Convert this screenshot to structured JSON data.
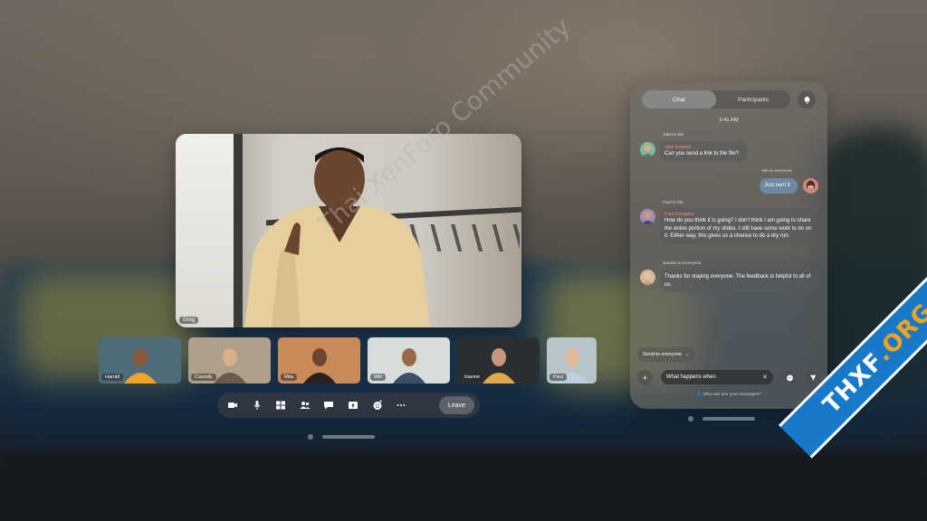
{
  "main_video": {
    "name": "Greg"
  },
  "participants": [
    {
      "name": "Harold",
      "bg": "#4d6b78",
      "skin": "#8a5a3c",
      "shirt": "#f0a32a"
    },
    {
      "name": "Cassidy",
      "bg": "#b0a089",
      "skin": "#d9b08e",
      "shirt": "#6b5a48"
    },
    {
      "name": "Rita",
      "bg": "#c98b5a",
      "skin": "#6b4630",
      "shirt": "#2a2220"
    },
    {
      "name": "Will",
      "bg": "#d7ddd8",
      "skin": "#9a6a48",
      "shirt": "#3c4f66"
    },
    {
      "name": "Joanne",
      "bg": "#2a2f33",
      "skin": "#c7957a",
      "shirt": "#e0a84a"
    },
    {
      "name": "Paul",
      "bg": "#b9c4c8",
      "skin": "#e0b89a",
      "shirt": "#bcd0e0"
    }
  ],
  "toolbar": {
    "icons": [
      "video-icon",
      "microphone-icon",
      "grid-view-icon",
      "participants-icon",
      "chat-icon",
      "share-screen-icon",
      "reactions-icon",
      "more-icon"
    ],
    "leave_label": "Leave"
  },
  "chat": {
    "tabs": {
      "chat": "Chat",
      "participants": "Participants"
    },
    "time": "9:41 AM",
    "messages": [
      {
        "meta": "Julie to Me",
        "from": "Julie Inclined",
        "text": "Can you send a link to the file?"
      },
      {
        "meta": "Me to everyone",
        "text": "Just sent it"
      },
      {
        "meta": "Paul to Me",
        "from": "Paul Gonzalez",
        "text": "How do you think it is going? I don't think I am going to share the entire portion of my slides. I still have some work to do on it. Either way, this gives us a chance to do a dry run."
      },
      {
        "meta": "Sandra to Everyone",
        "text": "Thanks for staying everyone. The feedback is helpful to all of us."
      }
    ],
    "send_to": "Send to everyone",
    "input_value": "What happens when",
    "who_can_see": "Who can see your messages?"
  },
  "watermark": "Thai XenForo Community",
  "ribbon": {
    "a": "THXF",
    "b": ".ORG"
  },
  "colors": {
    "accent": "#1979c9",
    "bubble_me": "#6e96b9",
    "sender_name": "#f08a8a"
  }
}
